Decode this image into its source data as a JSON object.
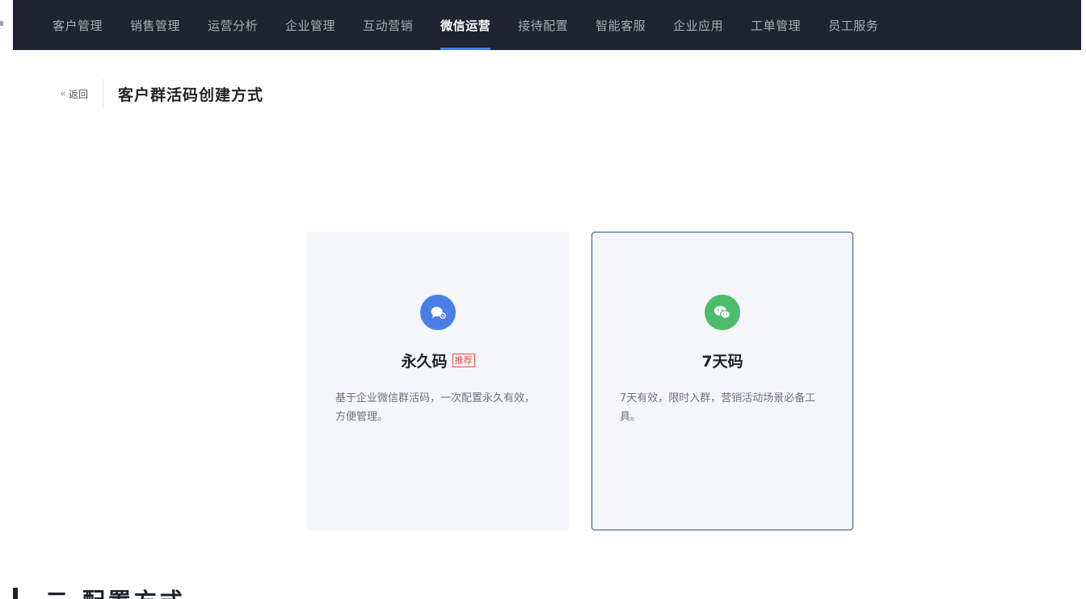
{
  "topnav": {
    "items": [
      {
        "label": "客户管理",
        "active": false
      },
      {
        "label": "销售管理",
        "active": false
      },
      {
        "label": "运营分析",
        "active": false
      },
      {
        "label": "企业管理",
        "active": false
      },
      {
        "label": "互动营销",
        "active": false
      },
      {
        "label": "微信运营",
        "active": true
      },
      {
        "label": "接待配置",
        "active": false
      },
      {
        "label": "智能客服",
        "active": false
      },
      {
        "label": "企业应用",
        "active": false
      },
      {
        "label": "工单管理",
        "active": false
      },
      {
        "label": "员工服务",
        "active": false
      }
    ]
  },
  "header": {
    "back_arrows": "«",
    "back_label": "返回",
    "title": "客户群活码创建方式"
  },
  "cards": {
    "permanent": {
      "icon": "chat-bubble-icon",
      "title": "永久码",
      "tag": "推荐",
      "description": "基于企业微信群活码，一次配置永久有效，方便管理。"
    },
    "seven_day": {
      "icon": "wechat-icon",
      "title": "7天码",
      "description": "7天有效，限时入群，营销活动场景必备工具。"
    }
  },
  "bottom": {
    "heading": "二 配置方式"
  },
  "colors": {
    "nav_bg": "#1f2430",
    "active_underline": "#3d7cf3",
    "blue_icon": "#4a7fe8",
    "green_icon": "#4cbd6d",
    "tag_red": "#e5484d",
    "selected_border": "#3a5089"
  }
}
